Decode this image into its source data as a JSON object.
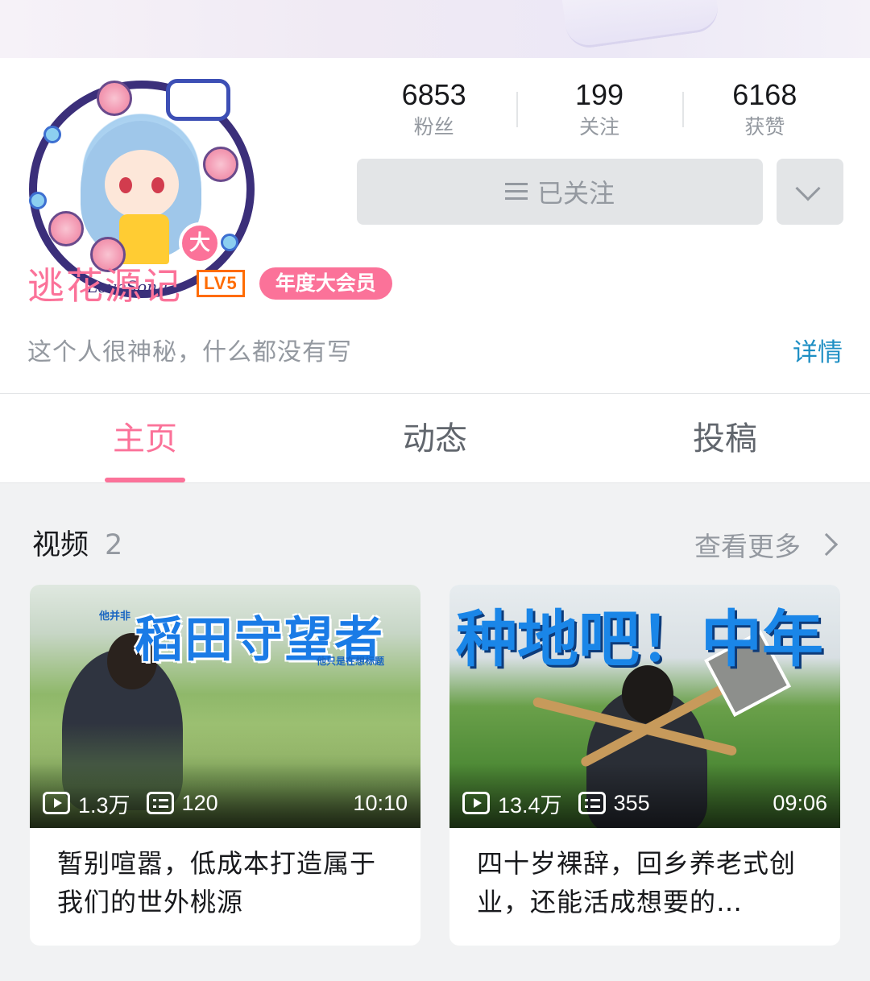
{
  "profile": {
    "username": "逃花源记",
    "level": "LV5",
    "vip_badge": "年度大会员",
    "avatar_badge": "大",
    "avatar_signature": "LoveSong",
    "bio": "这个人很神秘，什么都没有写",
    "detail_link": "详情",
    "stats": [
      {
        "value": "6853",
        "label": "粉丝"
      },
      {
        "value": "199",
        "label": "关注"
      },
      {
        "value": "6168",
        "label": "获赞"
      }
    ],
    "follow_button": "已关注"
  },
  "tabs": [
    {
      "label": "主页",
      "active": true
    },
    {
      "label": "动态",
      "active": false
    },
    {
      "label": "投稿",
      "active": false
    }
  ],
  "videos_section": {
    "title": "视频",
    "count": "2",
    "see_more": "查看更多"
  },
  "videos": [
    {
      "thumb_small_text": "他并非",
      "thumb_text": "稻田守望者",
      "thumb_sub_text": "他只是在想标题",
      "views": "1.3万",
      "danmaku": "120",
      "duration": "10:10",
      "title": "暂别喧嚣，低成本打造属于我们的世外桃源"
    },
    {
      "thumb_text": "种地吧！中年",
      "views": "13.4万",
      "danmaku": "355",
      "duration": "09:06",
      "title": "四十岁裸辞，回乡养老式创业，还能活成想要的…"
    }
  ],
  "colors": {
    "accent_pink": "#fb7299",
    "level_orange": "#ff6c00",
    "link_blue": "#1e8fc4",
    "muted_gray": "#9499a0"
  },
  "icons": [
    "menu-icon",
    "chevron-down-icon",
    "chevron-right-icon",
    "play-count-icon",
    "danmaku-icon"
  ]
}
